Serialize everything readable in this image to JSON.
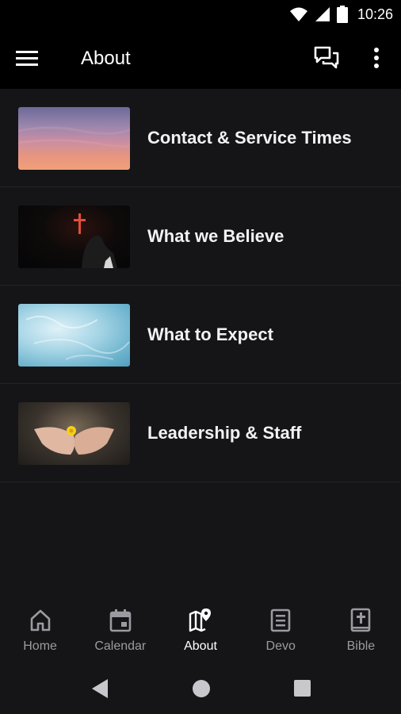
{
  "status_bar": {
    "time": "10:26",
    "icons": [
      "wifi-icon",
      "signal-icon",
      "battery-icon"
    ]
  },
  "app_bar": {
    "title": "About",
    "icons": [
      "menu-icon",
      "chat-icon",
      "more-vert-icon"
    ]
  },
  "list": {
    "items": [
      {
        "label": "Contact & Service Times",
        "thumbnail": "sunset-sky"
      },
      {
        "label": "What we Believe",
        "thumbnail": "cross-silhouette"
      },
      {
        "label": "What to Expect",
        "thumbnail": "water-surface"
      },
      {
        "label": "Leadership & Staff",
        "thumbnail": "hands-flower"
      }
    ]
  },
  "bottom_nav": {
    "items": [
      {
        "label": "Home",
        "icon": "home-icon",
        "active": false
      },
      {
        "label": "Calendar",
        "icon": "calendar-icon",
        "active": false
      },
      {
        "label": "About",
        "icon": "map-pin-icon",
        "active": true
      },
      {
        "label": "Devo",
        "icon": "document-icon",
        "active": false
      },
      {
        "label": "Bible",
        "icon": "bible-icon",
        "active": false
      }
    ]
  },
  "system_nav": {
    "icons": [
      "back-icon",
      "home-circle-icon",
      "recents-icon"
    ]
  },
  "colors": {
    "background": "#151518",
    "app_bar": "#000000",
    "active_label": "#ffffff",
    "inactive_label": "#9a9aa0"
  }
}
